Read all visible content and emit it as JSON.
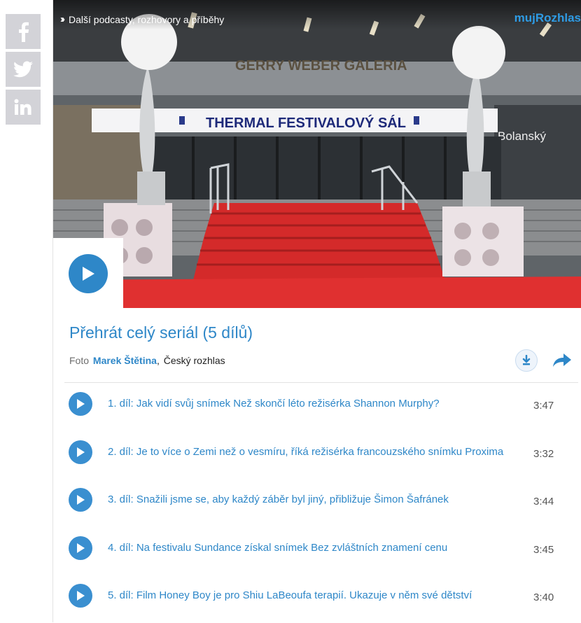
{
  "social": [
    {
      "name": "facebook",
      "icon": "facebook-icon"
    },
    {
      "name": "twitter",
      "icon": "twitter-icon"
    },
    {
      "name": "linkedin",
      "icon": "linkedin-icon"
    }
  ],
  "hero": {
    "link_text": "Další podcasty, rozhovory a příběhy",
    "brand": "mujRozhlas",
    "sign_main": "THERMAL FESTIVALOVÝ SÁL",
    "sign_upper": "GERRY WEBER GALERIA",
    "sign_right": "Bolanský"
  },
  "serial": {
    "title": "Přehrát celý seriál (5 dílů)",
    "credit_label": "Foto",
    "author": "Marek Štětina",
    "publisher": "Český rozhlas"
  },
  "colors": {
    "accent": "#2e87c8",
    "brand": "#2e9be4",
    "social_bg": "#d3d3d8"
  },
  "episodes": [
    {
      "title": "1. díl: Jak vidí svůj snímek Než skončí léto režisérka Shannon Murphy?",
      "duration": "3:47"
    },
    {
      "title": "2. díl: Je to více o Zemi než o vesmíru, říká režisérka francouzského snímku Proxima",
      "duration": "3:32"
    },
    {
      "title": "3. díl: Snažili jsme se, aby každý záběr byl jiný, přibližuje Šimon Šafránek",
      "duration": "3:44"
    },
    {
      "title": "4. díl: Na festivalu Sundance získal snímek Bez zvláštních znamení cenu",
      "duration": "3:45"
    },
    {
      "title": "5. díl: Film Honey Boy je pro Shiu LaBeoufa terapií. Ukazuje v něm své dětství",
      "duration": "3:40"
    }
  ]
}
